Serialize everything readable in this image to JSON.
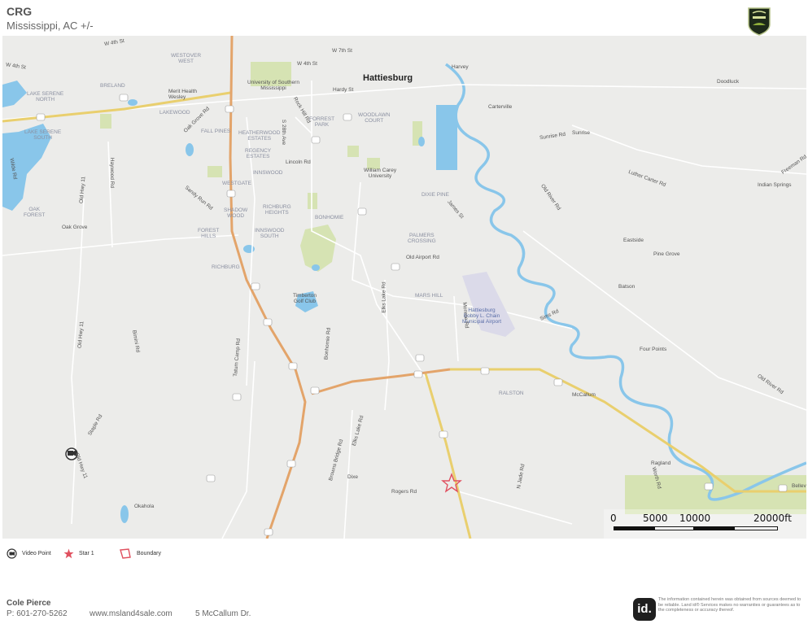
{
  "header": {
    "title": "CRG",
    "subtitle": "Mississippi,  AC +/-"
  },
  "colors": {
    "water": "#89c6ea",
    "green_area": "#cfe0a9",
    "highway_major": "#e3a46a",
    "highway_secondary": "#e9cf6e",
    "road": "#ffffff",
    "boundary": "#e0505f",
    "star": "#e0505f"
  },
  "map": {
    "labels": {
      "hattiesburg": "Hattiesburg",
      "w4th_a": "W 4th St",
      "w4th_b": "W 4th St",
      "w4th_c": "W 4th St",
      "w7th": "W 7th St",
      "harvey": "Harvey",
      "westover": "WESTOVER\nWEST",
      "breland": "BRELAND",
      "merit": "Merit Health\nWesley",
      "usm": "University of Southern\nMississippi",
      "hardy": "Hardy St",
      "doodluck": "Doodluck",
      "lake_serene_n": "LAKE SERENE\nNORTH",
      "lakewood": "LAKEWOOD",
      "oak_grove_rd": "Oak Grove Rd",
      "carterville": "Carterville",
      "forrest_park": "FORREST\nPARK",
      "woodlawn": "WOODLAWN\nCOURT",
      "sunrise": "Sunrise",
      "sunrise_rd": "Sunrise Rd",
      "lake_serene_s": "LAKE SERENE\nSOUTH",
      "fall_pines": "FALL PINES",
      "heatherwood": "HEATHERWOOD\nESTATES",
      "regency": "REGENCY\nESTATES",
      "s28th": "S 28th Ave",
      "lincoln": "Lincoln Rd",
      "william_carey": "William Carey\nUniversity",
      "luther_carter": "Luther Carter Rd",
      "freeman": "Freeman Rd",
      "indian_springs": "Indian Springs",
      "westgate": "WESTGATE",
      "innswood": "INNSWOOD",
      "haywood": "Haywood Rd",
      "old_hwy11_a": "Old Hwy 11",
      "dixie_pine": "DIXIE PINE",
      "old_river_rd_a": "Old River Rd",
      "sandy_run": "Sandy Run Rd",
      "shadow_wood": "SHADOW\nWOOD",
      "richburg_heights": "RICHBURG\nHEIGHTS",
      "bonhomie": "BONHOMIE",
      "james_st": "James St",
      "oak_forest": "OAK\nFOREST",
      "oak_grove": "Oak Grove",
      "forest_hills": "FOREST\nHILLS",
      "innswood_south": "INNSWOOD\nSOUTH",
      "palmers": "PALMERS\nCROSSING",
      "eastside": "Eastside",
      "pine_grove": "Pine Grove",
      "old_airport": "Old Airport Rd",
      "richburg": "RICHBURG",
      "batson": "Batson",
      "timberton": "Timberton\nGolf Club",
      "mars_hill": "MARS HILL",
      "elks_lake_a": "Elks Lake Rd",
      "airport": "Hattiesburg\nBobby L. Chain\nMunicipal Airport",
      "old_hwy11_b": "Old Hwy 11",
      "tatum": "Tatum Camp Rd",
      "bonhomie_rd": "Bonhomie Rd",
      "sims_rd": "Sims Rd",
      "four_points": "Four Points",
      "old_river_rd_b": "Old River Rd",
      "ralston": "RALSTON",
      "mccallum": "McCallum",
      "staple_rd": "Staple Rd",
      "old_hwy11_c": "Old Hwy 11",
      "elks_lake_b": "Elks Lake Rd",
      "browns_bridge": "Browns Bridge Rd",
      "ragland": "Ragland",
      "rogers": "Rogers Rd",
      "dixe": "Dixe",
      "n_jade": "N Jade Rd",
      "worth_rd": "Worth Rd",
      "okahola": "Okahola",
      "belleville": "Bellev",
      "wilde_rd": "Wilde Rd",
      "rock_hill": "Rock Hill Rd",
      "monroe": "Monroe Rd",
      "bimini": "Bimini Rd"
    },
    "scale": {
      "labels": [
        "0",
        "5000",
        "10000",
        "20000ft"
      ]
    }
  },
  "legend": {
    "video": "Video Point",
    "star": "Star 1",
    "boundary": "Boundary"
  },
  "footer": {
    "name": "Cole  Pierce",
    "phone": "P: 601-270-5262",
    "website": "www.msland4sale.com",
    "address": "5 McCallum Dr.",
    "logo_text": "id.",
    "disclaimer": "The information contained herein was obtained from sources deemed to be reliable. Land id® Services makes no warranties or guarantees as to the completeness or accuracy thereof."
  }
}
